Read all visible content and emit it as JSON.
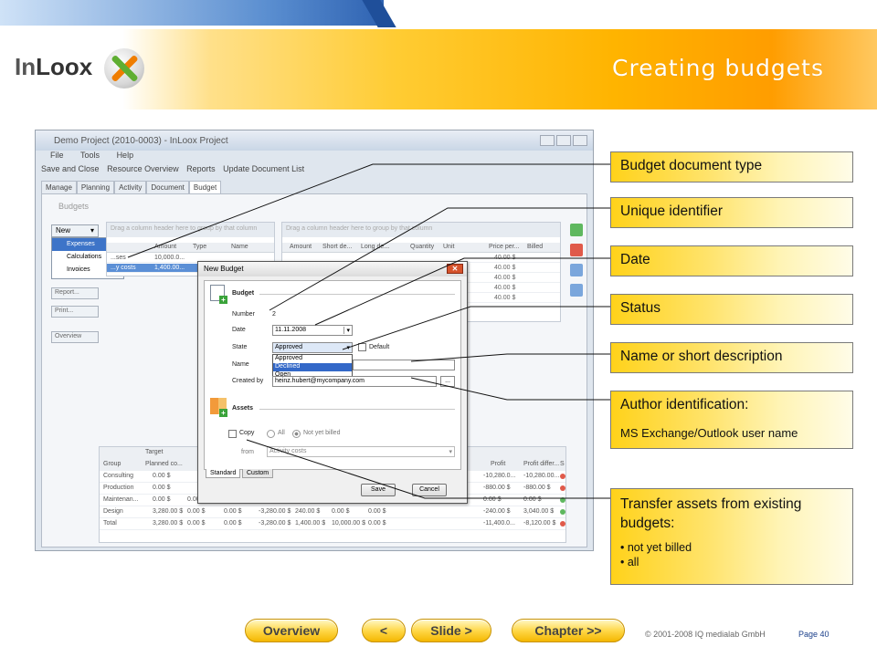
{
  "header": {
    "logo_text_in": "In",
    "logo_text_loox": "Loox",
    "title": "Creating budgets"
  },
  "screenshot": {
    "window_title": "Demo Project (2010-0003) - InLoox Project",
    "menu": [
      "File",
      "Tools",
      "Help"
    ],
    "toolbar": [
      "Save and Close",
      "Resource Overview",
      "Reports",
      "Update Document List"
    ],
    "tabs": [
      "Manage",
      "Planning",
      "Activity",
      "Document",
      "Budget"
    ],
    "section_label": "Budgets",
    "new_button": "New",
    "new_menu": [
      "Expenses",
      "Calculations",
      "Invoices"
    ],
    "side_buttons": [
      "Report...",
      "Print...",
      "Overview"
    ],
    "grid1_hint": "Drag a column header here to group by that column",
    "grid1_cols": [
      "Amount",
      "Type",
      "Name"
    ],
    "grid1_rows": [
      [
        "10,000.0...",
        "",
        ""
      ],
      [
        "1,400.00...",
        "",
        ""
      ]
    ],
    "grid1_row_labels": [
      "...ses",
      "...y costs"
    ],
    "grid2_hint": "Drag a column header here to group by that column",
    "grid2_cols": [
      "Amount",
      "Short de...",
      "Long de...",
      "Quantity",
      "Unit",
      "Price per...",
      "Billed"
    ],
    "grid2_prices": [
      "40.00 $",
      "40.00 $",
      "40.00 $",
      "40.00 $",
      "40.00 $"
    ],
    "grid3_target": "Target",
    "grid3_cols": [
      "Group",
      "Planned co..."
    ],
    "grid3_right_cols": [
      "Profit",
      "Profit differ...",
      "S"
    ],
    "grid3_rows": [
      {
        "group": "Consulting",
        "planned": "0.00 $",
        "mid": [
          "",
          "",
          "",
          "",
          "",
          ""
        ],
        "profit": "-10,280.0...",
        "diff": "-10,280.00..."
      },
      {
        "group": "Production",
        "planned": "0.00 $",
        "mid": [
          "",
          "",
          "",
          "",
          "",
          ""
        ],
        "profit": "-880.00 $",
        "diff": "-880.00 $"
      },
      {
        "group": "Maintenan...",
        "planned": "0.00 $",
        "mid": [
          "0.00 $",
          "0.00 $",
          "0.00 $",
          "0.00 $",
          "0.00 $",
          "0.00 $"
        ],
        "profit": "0.00 $",
        "diff": "0.00 $"
      },
      {
        "group": "Design",
        "planned": "3,280.00 $",
        "mid": [
          "0.00 $",
          "0.00 $",
          "-3,280.00 $",
          "240.00 $",
          "0.00 $",
          "0.00 $"
        ],
        "profit": "-240.00 $",
        "diff": "3,040.00 $"
      },
      {
        "group": "Total",
        "planned": "3,280.00 $",
        "mid": [
          "0.00 $",
          "0.00 $",
          "-3,280.00 $",
          "1,400.00 $",
          "10,000.00 $",
          "0.00 $"
        ],
        "profit": "-11,400.0...",
        "diff": "-8,120.00 $"
      }
    ]
  },
  "dialog": {
    "title": "New Budget",
    "budget_heading": "Budget",
    "number_label": "Number",
    "number_value": "2",
    "date_label": "Date",
    "date_value": "11.11.2008",
    "state_label": "State",
    "state_value": "Approved",
    "state_options": [
      "Approved",
      "Declined",
      "Open"
    ],
    "default_label": "Default",
    "name_label": "Name",
    "created_label": "Created by",
    "created_value": "heinz.hubert@mycompany.com",
    "browse": "...",
    "assets_heading": "Assets",
    "copy_label": "Copy",
    "all_label": "All",
    "notbilled_label": "Not yet billed",
    "from_label": "from",
    "from_value": "Activity costs",
    "tab_standard": "Standard",
    "tab_custom": "Custom",
    "save": "Save",
    "cancel": "Cancel"
  },
  "callouts": {
    "c1": "Budget document type",
    "c2": "Unique identifier",
    "c3": "Date",
    "c4": "Status",
    "c5": "Name or short description",
    "c6": "Author identification:",
    "c6_sub": "MS Exchange/Outlook user name",
    "c7": "Transfer assets from existing budgets:",
    "c7_items": [
      "• not yet billed",
      "• all"
    ]
  },
  "footer": {
    "overview": "Overview",
    "prev": "<",
    "slide": "Slide >",
    "chapter": "Chapter >>",
    "copyright": "© 2001-2008 IQ medialab GmbH",
    "page": "Page 40"
  },
  "colors": {
    "accent": "#ffb400",
    "blue": "#2f63b2"
  }
}
